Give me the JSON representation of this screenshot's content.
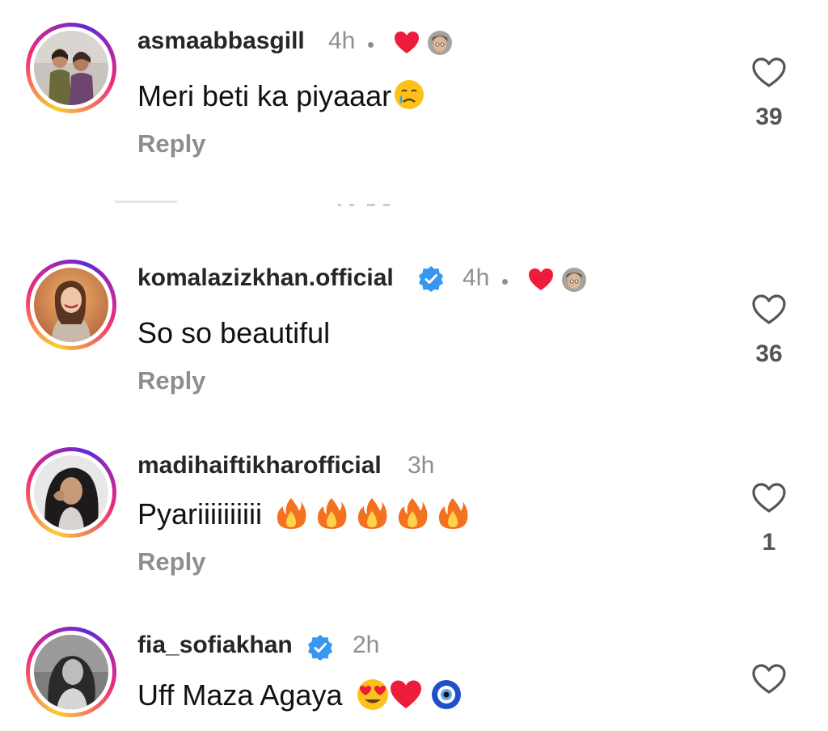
{
  "comments": [
    {
      "username": "asmaabbasgill",
      "time": "4h",
      "text": "Meri beti ka piyaaar",
      "reply_label": "Reply",
      "likes": "39",
      "verified": false,
      "liked_by_creator": true
    },
    {
      "username": "komalazizkhan.official",
      "time": "4h",
      "text": "So so beautiful",
      "reply_label": "Reply",
      "likes": "36",
      "verified": true,
      "liked_by_creator": true
    },
    {
      "username": "madihaiftikharofficial",
      "time": "3h",
      "text": "Pyariiiiiiiiii",
      "reply_label": "Reply",
      "likes": "1",
      "verified": false,
      "liked_by_creator": false
    },
    {
      "username": "fia_sofiakhan",
      "time": "2h",
      "text": "Uff Maza Agaya",
      "reply_label": "",
      "likes": "",
      "verified": true,
      "liked_by_creator": false
    }
  ],
  "icons": {
    "like": "heart-outline-icon",
    "creator_like": "red-heart-icon",
    "verified": "verified-badge-icon"
  },
  "colors": {
    "username": "#262626",
    "meta": "#8e8e8e",
    "verified_blue": "#3897f0",
    "heart_red": "#ed1c3a"
  }
}
